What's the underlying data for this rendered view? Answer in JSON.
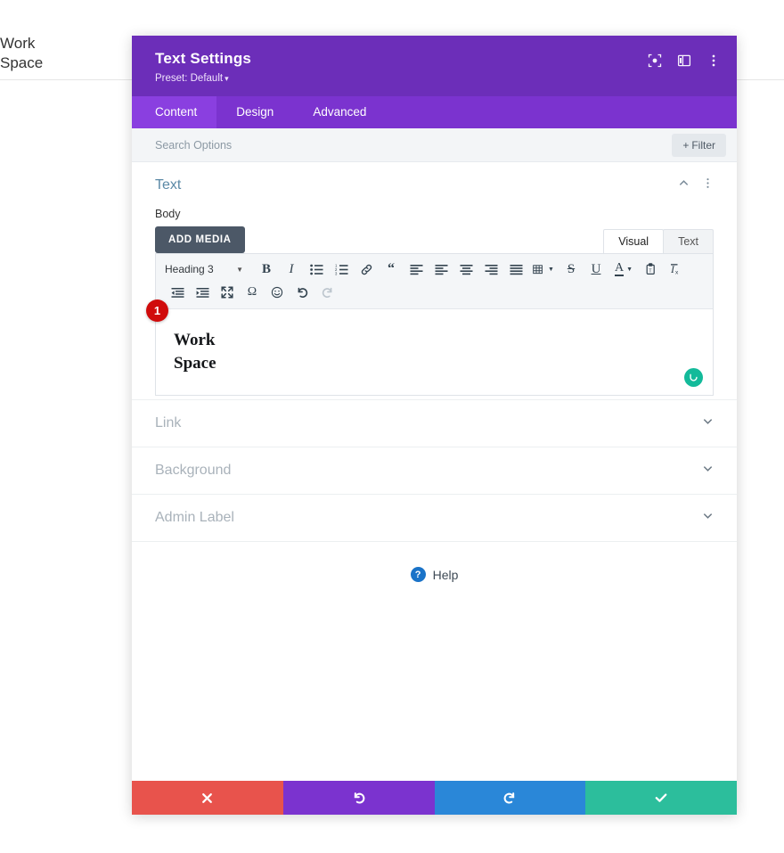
{
  "background_page": {
    "text": "Work\nSpace"
  },
  "modal": {
    "title": "Text Settings",
    "preset_label": "Preset: Default",
    "preset_caret": "▾",
    "header_icons": [
      {
        "name": "focus-target-icon"
      },
      {
        "name": "panel-layout-icon"
      },
      {
        "name": "more-vertical-icon"
      }
    ],
    "tabs": [
      {
        "label": "Content",
        "active": true
      },
      {
        "label": "Design",
        "active": false
      },
      {
        "label": "Advanced",
        "active": false
      }
    ],
    "search": {
      "placeholder": "Search Options",
      "value": ""
    },
    "filter_button": {
      "plus": "+",
      "label": "Filter"
    },
    "sections": [
      {
        "title": "Text",
        "state": "open"
      },
      {
        "title": "Link",
        "state": "closed"
      },
      {
        "title": "Background",
        "state": "closed"
      },
      {
        "title": "Admin Label",
        "state": "closed"
      }
    ],
    "text_section": {
      "field_label": "Body",
      "add_media_label": "ADD MEDIA",
      "editor_tabs": [
        {
          "label": "Visual",
          "active": true
        },
        {
          "label": "Text",
          "active": false
        }
      ],
      "toolbar": {
        "format_select": "Heading 3",
        "row1": [
          {
            "name": "bold-icon",
            "glyph": "B"
          },
          {
            "name": "italic-icon",
            "glyph": "I"
          },
          {
            "name": "bullet-list-icon",
            "glyph": ""
          },
          {
            "name": "numbered-list-icon",
            "glyph": ""
          },
          {
            "name": "link-icon",
            "glyph": ""
          },
          {
            "name": "blockquote-icon",
            "glyph": "“"
          },
          {
            "name": "align-left-icon",
            "glyph": ""
          },
          {
            "name": "align-left-2-icon",
            "glyph": ""
          },
          {
            "name": "align-center-icon",
            "glyph": ""
          },
          {
            "name": "align-right-icon",
            "glyph": ""
          },
          {
            "name": "align-justify-icon",
            "glyph": ""
          },
          {
            "name": "table-icon",
            "glyph": ""
          },
          {
            "name": "strikethrough-icon",
            "glyph": "S"
          },
          {
            "name": "underline-icon",
            "glyph": "U"
          },
          {
            "name": "text-color-icon",
            "glyph": "A"
          },
          {
            "name": "paste-as-text-icon",
            "glyph": ""
          },
          {
            "name": "clear-formatting-icon",
            "glyph": ""
          }
        ],
        "row2": [
          {
            "name": "outdent-icon"
          },
          {
            "name": "indent-icon"
          },
          {
            "name": "fullscreen-icon"
          },
          {
            "name": "special-character-icon",
            "glyph": "Ω"
          },
          {
            "name": "emoji-icon"
          },
          {
            "name": "undo-icon"
          },
          {
            "name": "redo-icon",
            "disabled": true
          }
        ]
      },
      "editor_content": "Work\nSpace",
      "badge_number": "1",
      "grammar_indicator": "grammarly-ok"
    },
    "help": {
      "icon_glyph": "?",
      "label": "Help"
    },
    "footer_buttons": [
      {
        "name": "cancel-button",
        "icon": "close-icon",
        "color": "#e8534c"
      },
      {
        "name": "undo-button",
        "icon": "undo-icon",
        "color": "#7b33cf"
      },
      {
        "name": "redo-button",
        "icon": "redo-icon",
        "color": "#2a87d8"
      },
      {
        "name": "save-button",
        "icon": "check-icon",
        "color": "#2cbe9c"
      }
    ]
  },
  "colors": {
    "header_purple": "#6c2eb9",
    "tabs_purple": "#7b33cf",
    "tab_active_purple": "#8a3fe0",
    "section_title_blue": "#5b89a6",
    "badge_red": "#d00b0b",
    "grammarly_teal": "#13ba9a"
  }
}
